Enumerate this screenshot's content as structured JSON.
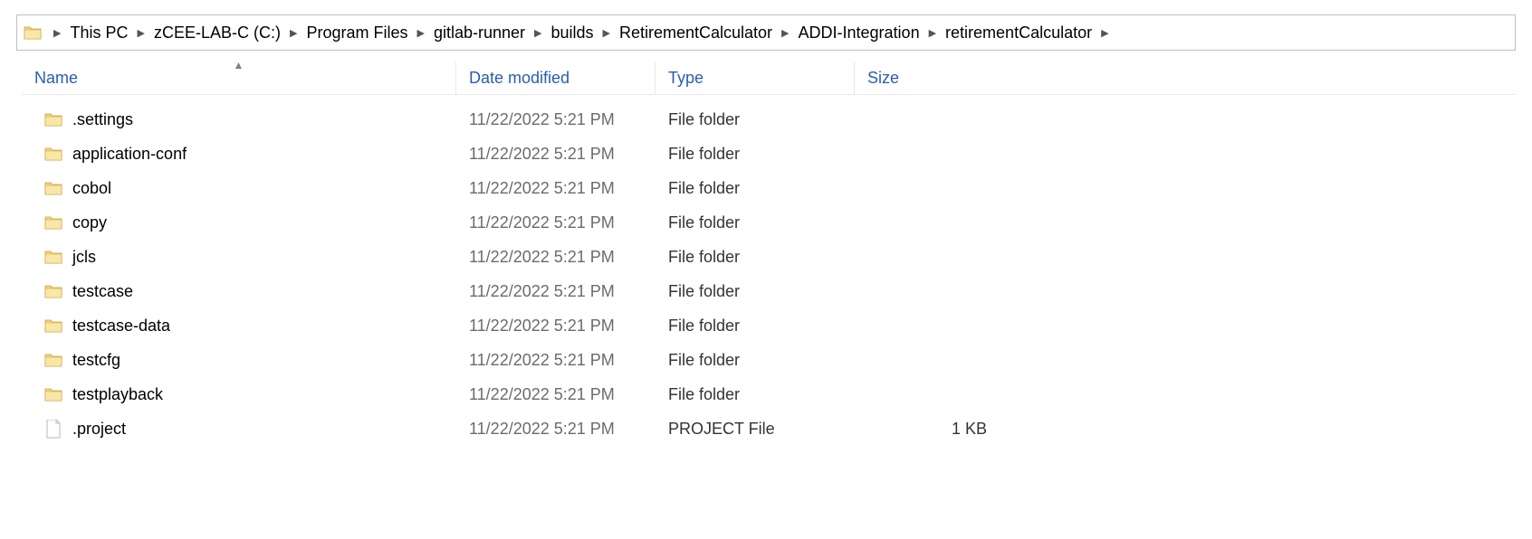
{
  "breadcrumb": {
    "items": [
      "This PC",
      "zCEE-LAB-C (C:)",
      "Program Files",
      "gitlab-runner",
      "builds",
      "RetirementCalculator",
      "ADDI-Integration",
      "retirementCalculator"
    ]
  },
  "columns": {
    "name": "Name",
    "date": "Date modified",
    "type": "Type",
    "size": "Size"
  },
  "rows": [
    {
      "icon": "folder",
      "name": ".settings",
      "date": "11/22/2022 5:21 PM",
      "type": "File folder",
      "size": ""
    },
    {
      "icon": "folder",
      "name": "application-conf",
      "date": "11/22/2022 5:21 PM",
      "type": "File folder",
      "size": ""
    },
    {
      "icon": "folder",
      "name": "cobol",
      "date": "11/22/2022 5:21 PM",
      "type": "File folder",
      "size": ""
    },
    {
      "icon": "folder",
      "name": "copy",
      "date": "11/22/2022 5:21 PM",
      "type": "File folder",
      "size": ""
    },
    {
      "icon": "folder",
      "name": "jcls",
      "date": "11/22/2022 5:21 PM",
      "type": "File folder",
      "size": ""
    },
    {
      "icon": "folder",
      "name": "testcase",
      "date": "11/22/2022 5:21 PM",
      "type": "File folder",
      "size": ""
    },
    {
      "icon": "folder",
      "name": "testcase-data",
      "date": "11/22/2022 5:21 PM",
      "type": "File folder",
      "size": ""
    },
    {
      "icon": "folder",
      "name": "testcfg",
      "date": "11/22/2022 5:21 PM",
      "type": "File folder",
      "size": ""
    },
    {
      "icon": "folder",
      "name": "testplayback",
      "date": "11/22/2022 5:21 PM",
      "type": "File folder",
      "size": ""
    },
    {
      "icon": "file",
      "name": ".project",
      "date": "11/22/2022 5:21 PM",
      "type": "PROJECT File",
      "size": "1 KB"
    }
  ]
}
